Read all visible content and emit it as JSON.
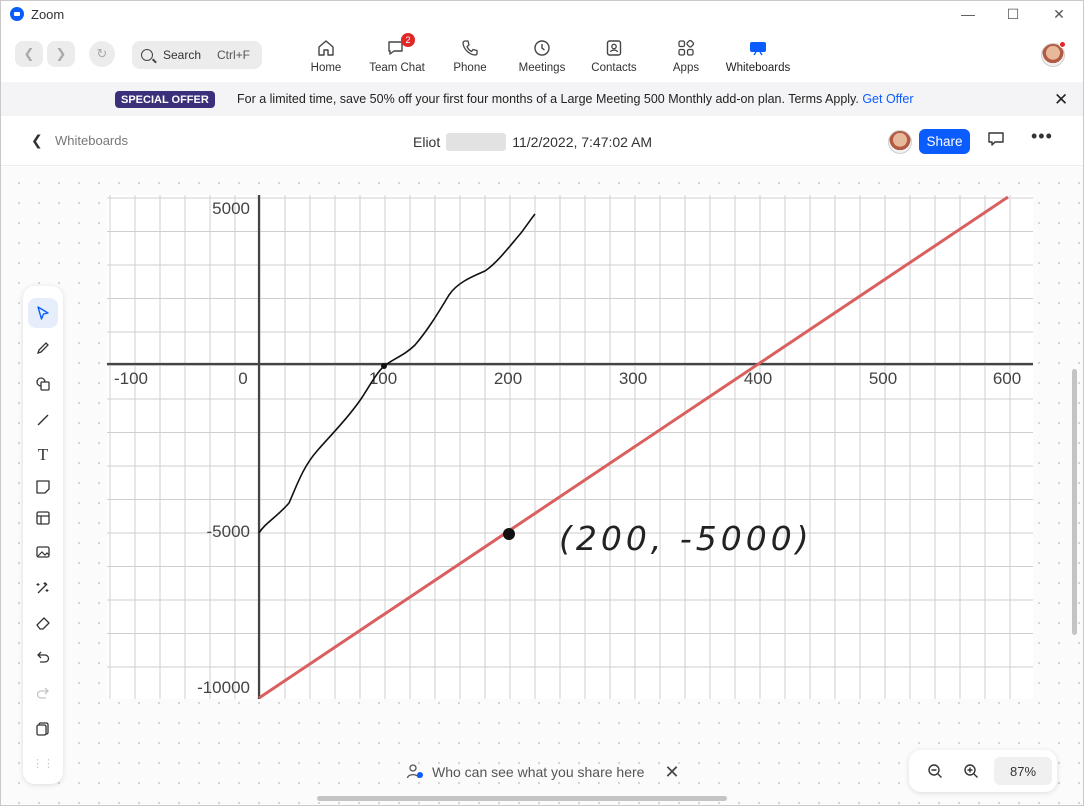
{
  "app": {
    "title": "Zoom"
  },
  "toolbar": {
    "search_label": "Search",
    "search_shortcut": "Ctrl+F",
    "tabs": [
      {
        "label": "Home",
        "icon": "home-icon"
      },
      {
        "label": "Team Chat",
        "icon": "chat-icon",
        "badge": "2"
      },
      {
        "label": "Phone",
        "icon": "phone-icon"
      },
      {
        "label": "Meetings",
        "icon": "clock-icon"
      },
      {
        "label": "Contacts",
        "icon": "contacts-icon"
      },
      {
        "label": "Apps",
        "icon": "apps-icon"
      },
      {
        "label": "Whiteboards",
        "icon": "whiteboard-icon",
        "active": true
      }
    ]
  },
  "offer": {
    "tag": "SPECIAL OFFER",
    "text": "For a limited time, save 50% off your first four months of a Large Meeting 500 Monthly add-on plan. Terms Apply.",
    "link": "Get Offer"
  },
  "whiteboard": {
    "back_label": "Whiteboards",
    "owner_first_name": "Eliot",
    "timestamp": "11/2/2022, 7:47:02 AM",
    "share_label": "Share"
  },
  "graph": {
    "x_ticks": [
      "-100",
      "0",
      "100",
      "200",
      "300",
      "400",
      "500",
      "600"
    ],
    "y_ticks": [
      "5000",
      "-5000",
      "-10000"
    ],
    "annotation": "(200, -5000)",
    "line_color": "#d9605f",
    "pen_color": "#111111"
  },
  "notice": {
    "text": "Who can see what you share here"
  },
  "zoom": {
    "level": "87%"
  }
}
